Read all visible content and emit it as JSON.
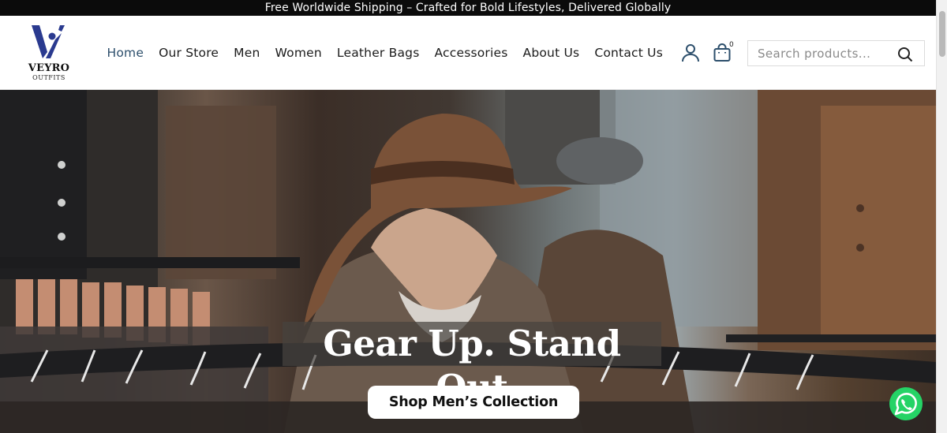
{
  "announcement": "Free Worldwide Shipping – Crafted for Bold Lifestyles, Delivered Globally",
  "brand": {
    "name": "VEYRO",
    "tagline": "OUTFITS",
    "accent": "#2a3a8f"
  },
  "nav": {
    "items": [
      {
        "label": "Home",
        "active": true
      },
      {
        "label": "Our Store",
        "active": false
      },
      {
        "label": "Men",
        "active": false
      },
      {
        "label": "Women",
        "active": false
      },
      {
        "label": "Leather Bags",
        "active": false
      },
      {
        "label": "Accessories",
        "active": false
      },
      {
        "label": "About Us",
        "active": false
      },
      {
        "label": "Contact Us",
        "active": false
      }
    ],
    "active_color": "#2d4f6c"
  },
  "header_icons": {
    "account": "user-icon",
    "cart": "shopping-bag-icon",
    "cart_count": "0"
  },
  "search": {
    "placeholder": "Search products...",
    "value": "",
    "icon": "search-icon"
  },
  "hero": {
    "headline": "Gear Up. Stand Out",
    "cta_label": "Shop Men’s Collection"
  },
  "floating": {
    "chat_icon": "whatsapp-icon",
    "chat_color": "#25d366"
  }
}
